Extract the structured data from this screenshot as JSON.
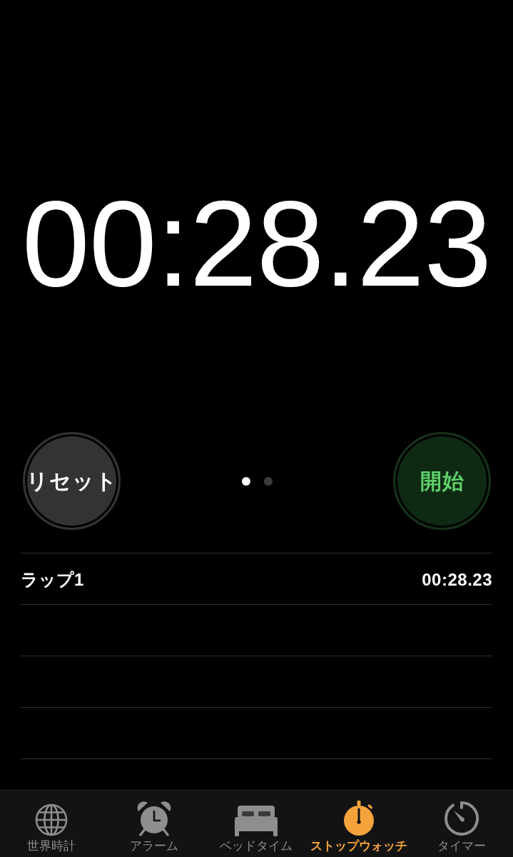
{
  "timer": {
    "display": "00:28.23"
  },
  "controls": {
    "buttons": [
      {
        "label": "リセット",
        "kind": "reset"
      },
      {
        "label": "開始",
        "kind": "start"
      }
    ],
    "page_dots": [
      {
        "selected": true
      },
      {
        "selected": false
      }
    ]
  },
  "laps": [
    {
      "label": "ラップ1",
      "time": "00:28.23"
    }
  ],
  "tab_bar": {
    "tabs": [
      {
        "label": "世界時計",
        "kind": "globe",
        "selected": false
      },
      {
        "label": "アラーム",
        "kind": "alarm",
        "selected": false
      },
      {
        "label": "ベッドタイム",
        "kind": "bed",
        "selected": false
      },
      {
        "label": "ストップウォッチ",
        "kind": "stopwatch",
        "selected": true
      },
      {
        "label": "タイマー",
        "kind": "timer",
        "selected": false
      }
    ]
  }
}
